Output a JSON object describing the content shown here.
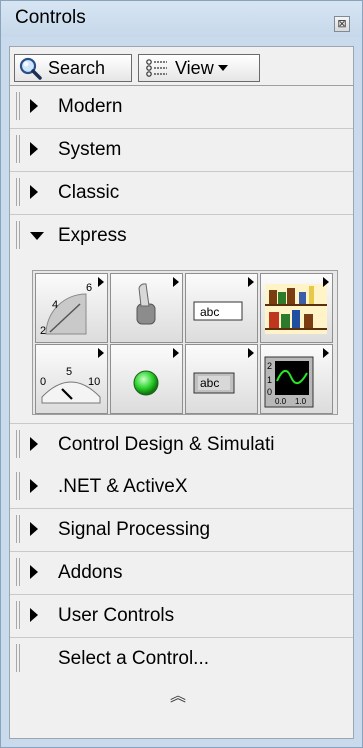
{
  "window": {
    "title": "Controls",
    "close_glyph": "⊠"
  },
  "toolbar": {
    "search_label": "Search",
    "view_label": "View"
  },
  "categories": [
    {
      "label": "Modern",
      "state": "collapsed"
    },
    {
      "label": "System",
      "state": "collapsed"
    },
    {
      "label": "Classic",
      "state": "collapsed"
    },
    {
      "label": "Express",
      "state": "expanded"
    },
    {
      "label": "Control Design & Simulati",
      "state": "collapsed"
    },
    {
      "label": ".NET & ActiveX",
      "state": "collapsed"
    },
    {
      "label": "Signal Processing",
      "state": "collapsed"
    },
    {
      "label": "Addons",
      "state": "collapsed"
    },
    {
      "label": "User Controls",
      "state": "collapsed"
    }
  ],
  "palette": {
    "icons": [
      {
        "name": "numeric-controls-icon",
        "labels": [
          "6",
          "4",
          "2"
        ]
      },
      {
        "name": "toggle-switch-icon"
      },
      {
        "name": "text-controls-icon",
        "text": "abc"
      },
      {
        "name": "user-controls-icon"
      },
      {
        "name": "numeric-indicators-icon",
        "labels": [
          "0",
          "5",
          "10"
        ]
      },
      {
        "name": "led-indicator-icon"
      },
      {
        "name": "text-indicators-icon",
        "text": "abc"
      },
      {
        "name": "graph-indicators-icon",
        "labels": [
          "2",
          "1",
          "0",
          "0.0",
          "1.0"
        ]
      }
    ]
  },
  "footer": {
    "select_label": "Select a Control...",
    "collapse_glyph": "︽"
  },
  "colors": {
    "window_bg": "#c8daeb",
    "panel_bg": "#f0f0f0",
    "led_green": "#2fd42f",
    "graph_trace": "#27e827"
  }
}
